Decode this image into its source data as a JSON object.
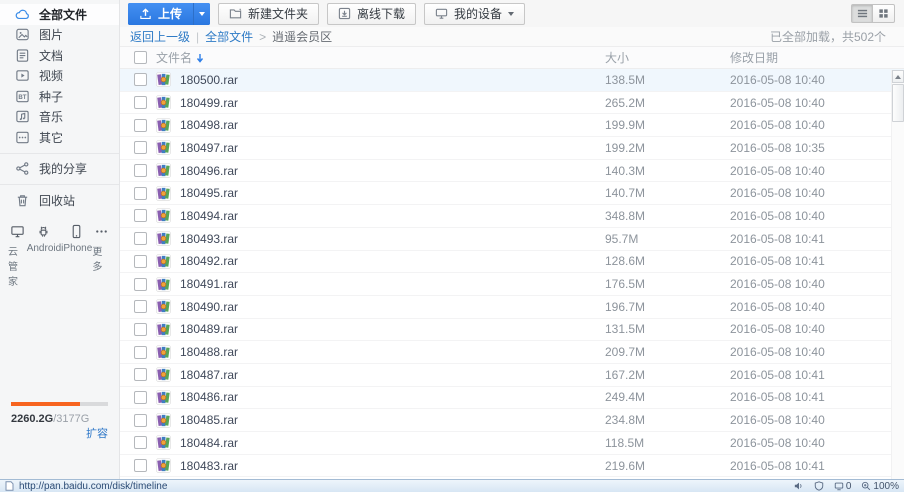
{
  "sidebar": {
    "items": [
      {
        "label": "全部文件"
      },
      {
        "label": "图片"
      },
      {
        "label": "文档"
      },
      {
        "label": "视频"
      },
      {
        "label": "种子"
      },
      {
        "label": "音乐"
      },
      {
        "label": "其它"
      }
    ],
    "share": "我的分享",
    "recycle": "回收站",
    "devices": [
      {
        "label": "云管家"
      },
      {
        "label": "Android"
      },
      {
        "label": "iPhone"
      },
      {
        "label": "更多"
      }
    ],
    "storage": {
      "used": "2260.2G",
      "total": "/3177G",
      "expand": "扩容",
      "percent": 71
    }
  },
  "toolbar": {
    "upload": "上传",
    "new_folder": "新建文件夹",
    "offline_download": "离线下载",
    "my_device": "我的设备"
  },
  "breadcrumb": {
    "back": "返回上一级",
    "divider": "|",
    "root": "全部文件",
    "sep": ">",
    "current": "逍遥会员区",
    "status": "已全部加载，共502个"
  },
  "table": {
    "col_name": "文件名",
    "col_size": "大小",
    "col_date": "修改日期"
  },
  "files": [
    {
      "name": "180500.rar",
      "size": "138.5M",
      "date": "2016-05-08 10:40"
    },
    {
      "name": "180499.rar",
      "size": "265.2M",
      "date": "2016-05-08 10:40"
    },
    {
      "name": "180498.rar",
      "size": "199.9M",
      "date": "2016-05-08 10:40"
    },
    {
      "name": "180497.rar",
      "size": "199.2M",
      "date": "2016-05-08 10:35"
    },
    {
      "name": "180496.rar",
      "size": "140.3M",
      "date": "2016-05-08 10:40"
    },
    {
      "name": "180495.rar",
      "size": "140.7M",
      "date": "2016-05-08 10:40"
    },
    {
      "name": "180494.rar",
      "size": "348.8M",
      "date": "2016-05-08 10:40"
    },
    {
      "name": "180493.rar",
      "size": "95.7M",
      "date": "2016-05-08 10:41"
    },
    {
      "name": "180492.rar",
      "size": "128.6M",
      "date": "2016-05-08 10:41"
    },
    {
      "name": "180491.rar",
      "size": "176.5M",
      "date": "2016-05-08 10:40"
    },
    {
      "name": "180490.rar",
      "size": "196.7M",
      "date": "2016-05-08 10:40"
    },
    {
      "name": "180489.rar",
      "size": "131.5M",
      "date": "2016-05-08 10:40"
    },
    {
      "name": "180488.rar",
      "size": "209.7M",
      "date": "2016-05-08 10:40"
    },
    {
      "name": "180487.rar",
      "size": "167.2M",
      "date": "2016-05-08 10:41"
    },
    {
      "name": "180486.rar",
      "size": "249.4M",
      "date": "2016-05-08 10:41"
    },
    {
      "name": "180485.rar",
      "size": "234.8M",
      "date": "2016-05-08 10:40"
    },
    {
      "name": "180484.rar",
      "size": "118.5M",
      "date": "2016-05-08 10:40"
    },
    {
      "name": "180483.rar",
      "size": "219.6M",
      "date": "2016-05-08 10:41"
    }
  ],
  "statusbar": {
    "url": "http://pan.baidu.com/disk/timeline",
    "blocked_count": "0",
    "zoom": "100%"
  }
}
